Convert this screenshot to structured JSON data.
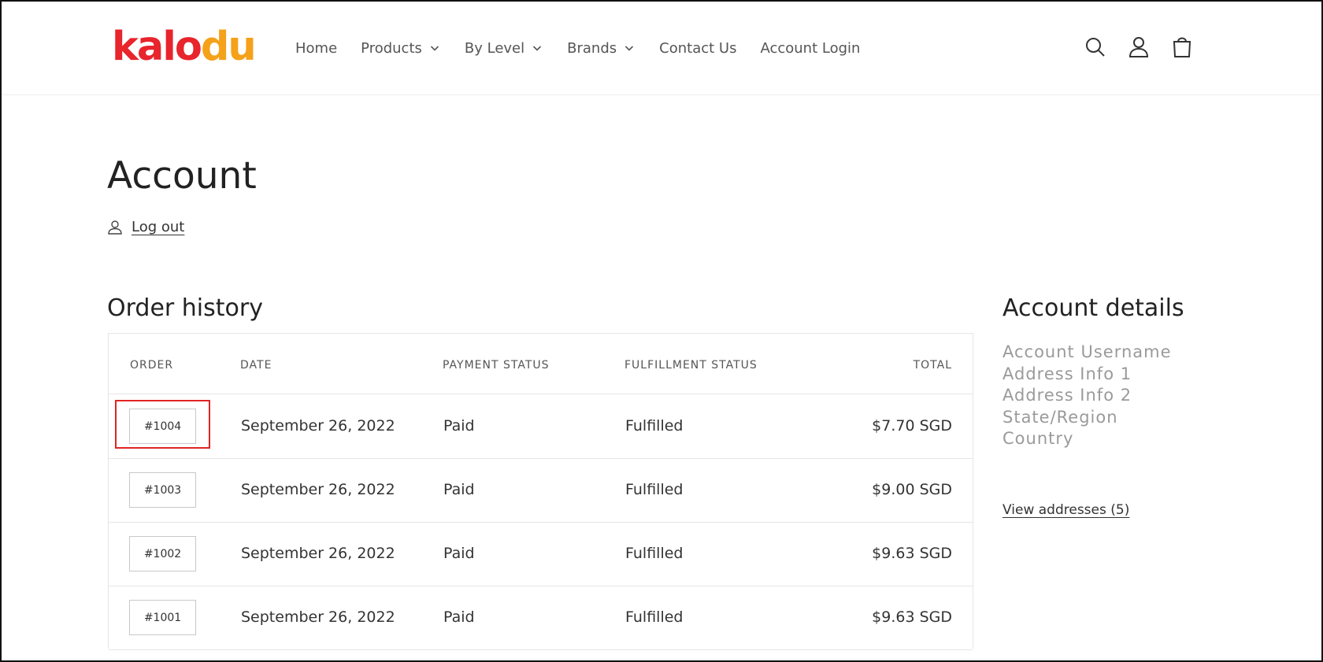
{
  "brand": {
    "logo_letters": [
      {
        "char": "k",
        "color": "#e8242c"
      },
      {
        "char": "a",
        "color": "#e8242c"
      },
      {
        "char": "l",
        "color": "#e8242c"
      },
      {
        "char": "o",
        "color": "#e8242c"
      },
      {
        "char": "d",
        "color": "#f5a11a"
      },
      {
        "char": "u",
        "color": "#f5a11a"
      }
    ]
  },
  "nav": {
    "items": [
      {
        "label": "Home",
        "dropdown": false
      },
      {
        "label": "Products",
        "dropdown": true
      },
      {
        "label": "By Level",
        "dropdown": true
      },
      {
        "label": "Brands",
        "dropdown": true
      },
      {
        "label": "Contact Us",
        "dropdown": false
      },
      {
        "label": "Account Login",
        "dropdown": false
      }
    ],
    "icons": [
      "search-icon",
      "account-icon",
      "cart-icon"
    ]
  },
  "page": {
    "title": "Account",
    "logout_label": "Log out"
  },
  "orders": {
    "title": "Order history",
    "headers": {
      "order": "ORDER",
      "date": "DATE",
      "payment": "PAYMENT STATUS",
      "fulfillment": "FULFILLMENT STATUS",
      "total": "TOTAL"
    },
    "rows": [
      {
        "order": "#1004",
        "date": "September 26, 2022",
        "payment": "Paid",
        "fulfillment": "Fulfilled",
        "total": "$7.70 SGD",
        "highlighted": true
      },
      {
        "order": "#1003",
        "date": "September 26, 2022",
        "payment": "Paid",
        "fulfillment": "Fulfilled",
        "total": "$9.00 SGD",
        "highlighted": false
      },
      {
        "order": "#1002",
        "date": "September 26, 2022",
        "payment": "Paid",
        "fulfillment": "Fulfilled",
        "total": "$9.63 SGD",
        "highlighted": false
      },
      {
        "order": "#1001",
        "date": "September 26, 2022",
        "payment": "Paid",
        "fulfillment": "Fulfilled",
        "total": "$9.63 SGD",
        "highlighted": false
      }
    ]
  },
  "account_details": {
    "title": "Account details",
    "lines": [
      "Account Username",
      "Address Info 1",
      "Address Info 2",
      "State/Region",
      "Country"
    ],
    "view_addresses_label": "View addresses (5)"
  },
  "colors": {
    "highlight": "#e02424",
    "muted_text": "#9a9a9a"
  }
}
